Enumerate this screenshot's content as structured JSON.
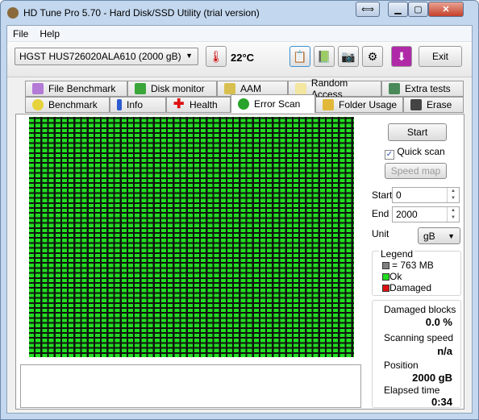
{
  "window": {
    "title": "HD Tune Pro 5.70 - Hard Disk/SSD Utility (trial version)"
  },
  "menu": {
    "file": "File",
    "help": "Help"
  },
  "toolbar": {
    "drive": "HGST HUS726020ALA610 (2000 gB)",
    "temperature": "22°C",
    "exit": "Exit"
  },
  "tabs": {
    "row1": [
      "File Benchmark",
      "Disk monitor",
      "AAM",
      "Random Access",
      "Extra tests"
    ],
    "row2": [
      "Benchmark",
      "Info",
      "Health",
      "Error Scan",
      "Folder Usage",
      "Erase"
    ],
    "active": "Error Scan"
  },
  "scan": {
    "start_button": "Start",
    "quick_scan_label": "Quick scan",
    "quick_scan_checked": true,
    "speed_map": "Speed map",
    "start_label": "Start",
    "start_value": "0",
    "end_label": "End",
    "end_value": "2000",
    "unit_label": "Unit",
    "unit_value": "gB"
  },
  "legend": {
    "title": "Legend",
    "block": "= 763 MB",
    "ok": "Ok",
    "damaged": "Damaged",
    "colors": {
      "block": "#808080",
      "ok": "#22dd22",
      "damaged": "#dd1111"
    }
  },
  "stats": {
    "damaged_label": "Damaged blocks",
    "damaged_value": "0.0 %",
    "speed_label": "Scanning speed",
    "speed_value": "n/a",
    "position_label": "Position",
    "position_value": "2000 gB",
    "elapsed_label": "Elapsed time",
    "elapsed_value": "0:34"
  },
  "scan_status": "all blocks ok"
}
